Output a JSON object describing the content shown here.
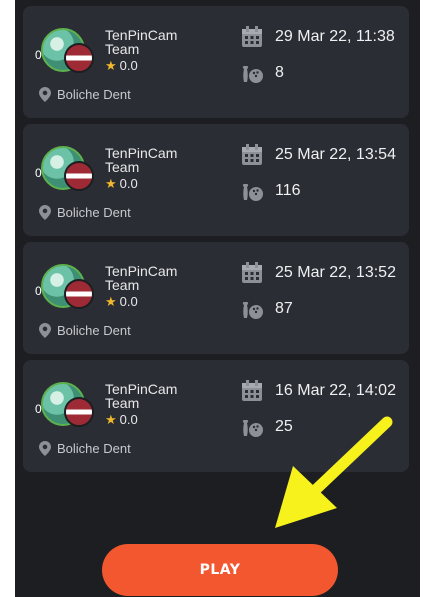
{
  "games": [
    {
      "team": "TenPinCam Team",
      "avatar_count": "0",
      "rating": "0.0",
      "location": "Boliche Dent",
      "date": "29 Mar 22, 11:38",
      "score": "8"
    },
    {
      "team": "TenPinCam Team",
      "avatar_count": "0",
      "rating": "0.0",
      "location": "Boliche Dent",
      "date": "25 Mar 22, 13:54",
      "score": "116"
    },
    {
      "team": "TenPinCam Team",
      "avatar_count": "0",
      "rating": "0.0",
      "location": "Boliche Dent",
      "date": "25 Mar 22, 13:52",
      "score": "87"
    },
    {
      "team": "TenPinCam Team",
      "avatar_count": "0",
      "rating": "0.0",
      "location": "Boliche Dent",
      "date": "16 Mar 22, 14:02",
      "score": "25"
    }
  ],
  "play_button": {
    "label": "PLAY"
  },
  "icons": {
    "calendar": "calendar-icon",
    "bowling": "bowling-icon",
    "location": "location-pin-icon",
    "star": "star-icon"
  },
  "colors": {
    "accent": "#f2572f",
    "star": "#f1b82d",
    "annotation_arrow": "#f7f21c"
  }
}
